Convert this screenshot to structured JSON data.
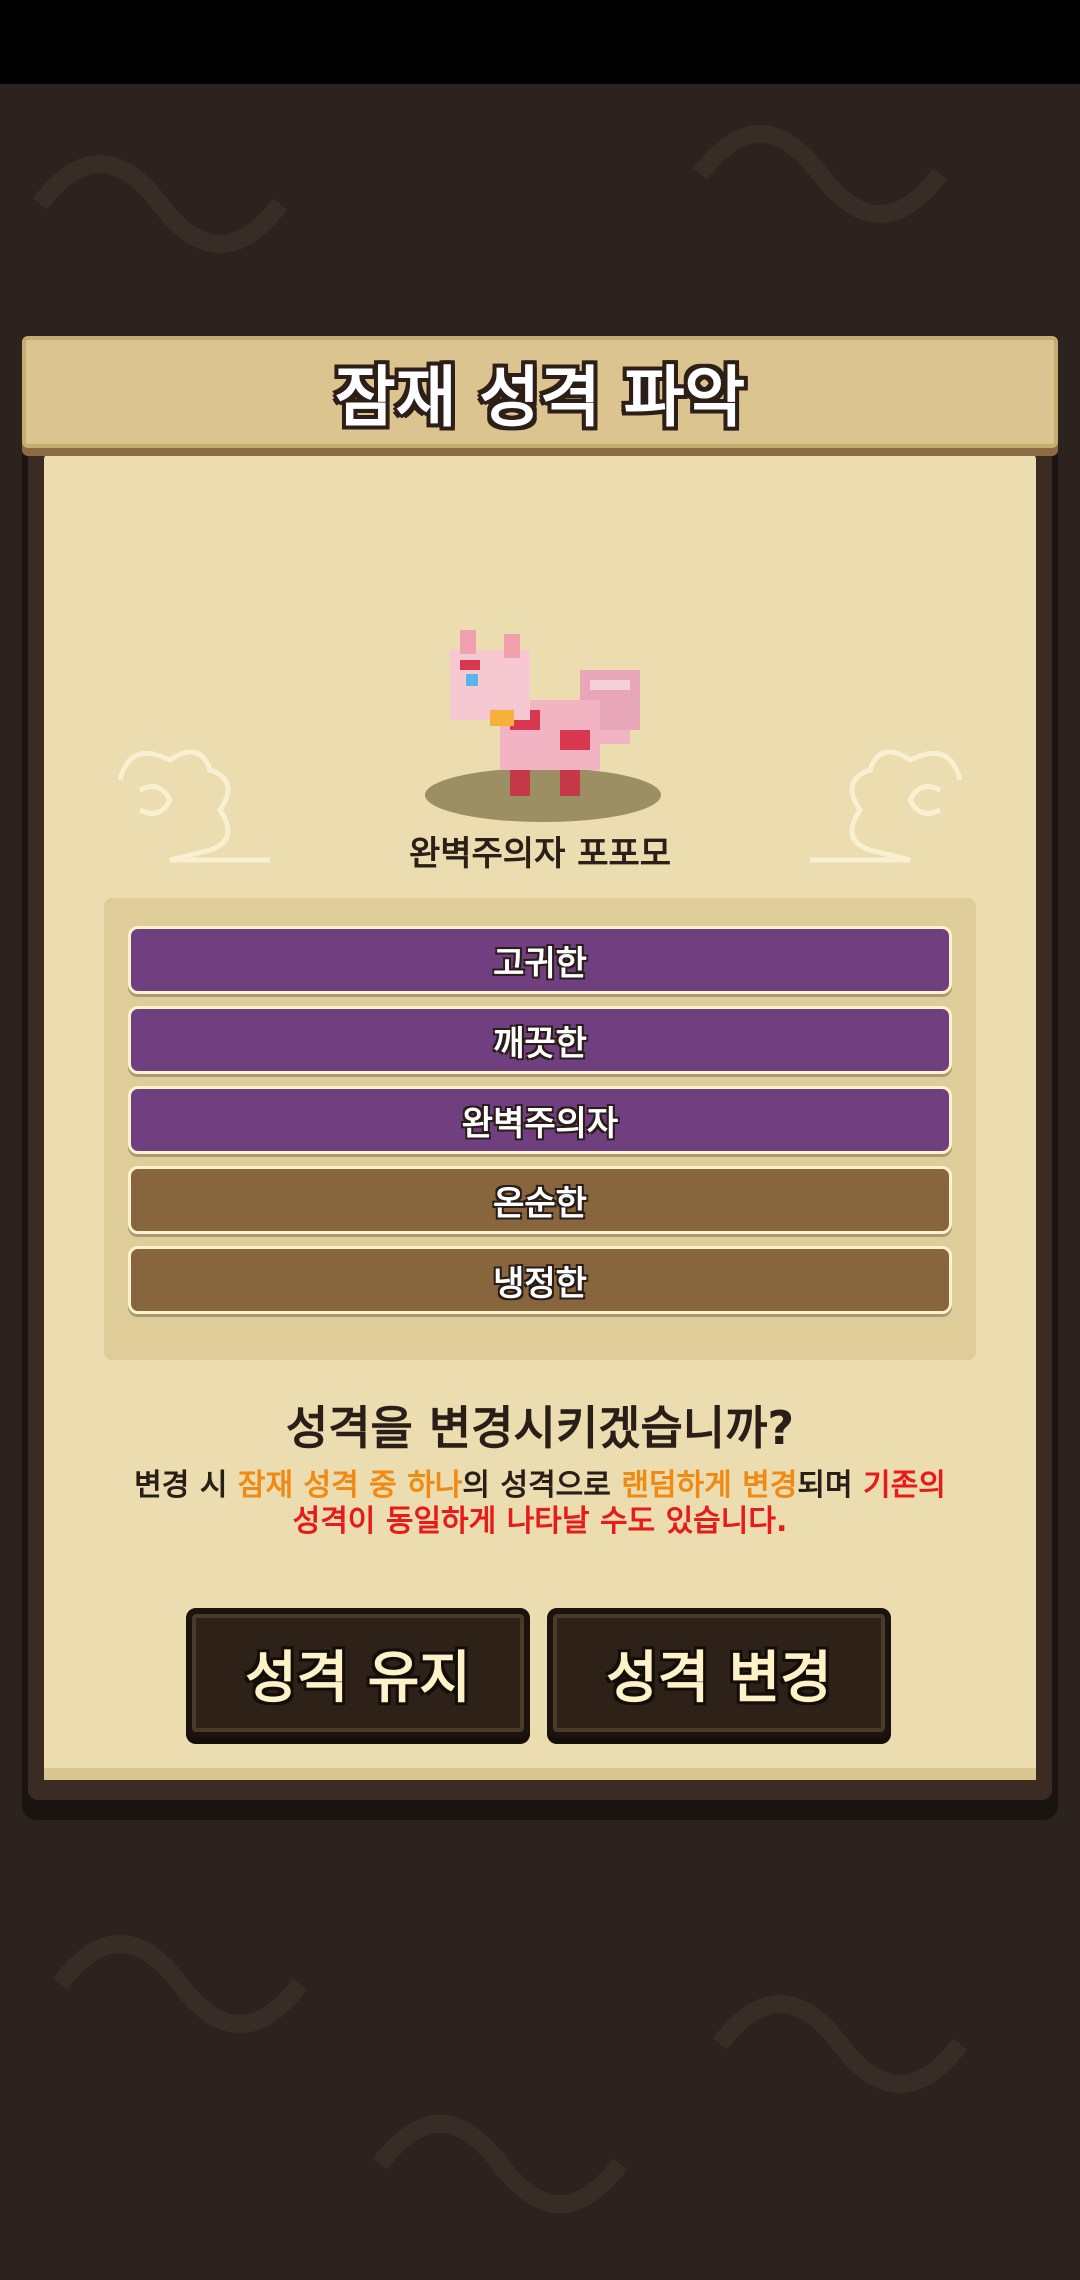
{
  "title": "잠재 성격 파악",
  "creature": {
    "name": "완벽주의자 포포모",
    "icon": "pink-dragon-sprite"
  },
  "personalities": [
    {
      "label": "고귀한",
      "color": "#6f3f80"
    },
    {
      "label": "깨끗한",
      "color": "#6f3f80"
    },
    {
      "label": "완벽주의자",
      "color": "#6f3f80"
    },
    {
      "label": "온순한",
      "color": "#87653d"
    },
    {
      "label": "냉정한",
      "color": "#87653d"
    }
  ],
  "question": "성격을 변경시키겠습니까?",
  "notice": {
    "p1": "변경 시 ",
    "p2": "잠재 성격 중 하나",
    "p3": "의 성격으로 ",
    "p4": "랜덤하게 변경",
    "p5": "되며 ",
    "p6": "기존의 성격이 동일하게 나타날 수도 있습니다."
  },
  "buttons": {
    "keep": "성격 유지",
    "change": "성격 변경"
  }
}
